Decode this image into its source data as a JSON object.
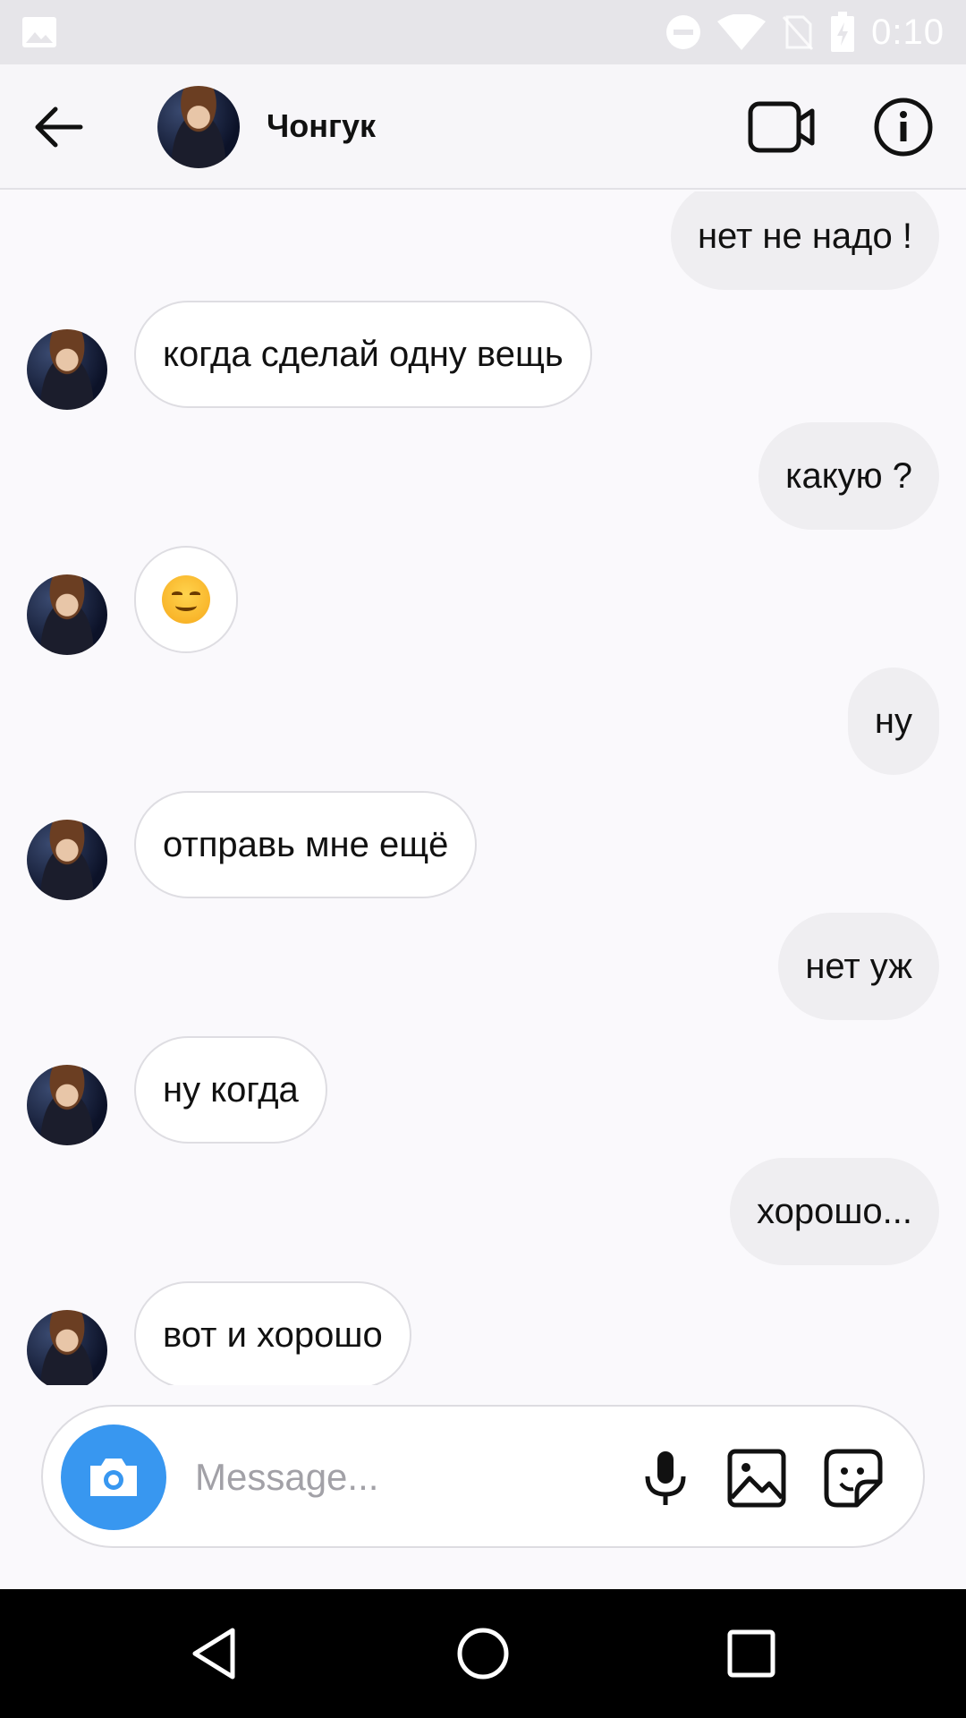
{
  "status_bar": {
    "time": "0:10",
    "icons": [
      "image-icon",
      "do-not-disturb-icon",
      "wifi-icon",
      "no-sim-icon",
      "battery-charging-icon"
    ]
  },
  "header": {
    "contact_name": "Чонгук",
    "icons": [
      "back-arrow-icon",
      "video-call-icon",
      "info-icon"
    ]
  },
  "messages": [
    {
      "from": "me",
      "text": "нет не надо !"
    },
    {
      "from": "them",
      "text": "когда сделай одну вещь"
    },
    {
      "from": "me",
      "text": "какую ?"
    },
    {
      "from": "them",
      "text": "",
      "emoji": "smiling-face-emoji"
    },
    {
      "from": "me",
      "text": "ну"
    },
    {
      "from": "them",
      "text": "отправь мне ещё"
    },
    {
      "from": "me",
      "text": "нет уж"
    },
    {
      "from": "them",
      "text": "ну когда"
    },
    {
      "from": "me",
      "text": "хорошо..."
    },
    {
      "from": "them",
      "text": "вот и хорошо"
    }
  ],
  "composer": {
    "placeholder": "Message...",
    "value": "",
    "camera_color": "#3897f0",
    "icons": [
      "camera-icon",
      "microphone-icon",
      "gallery-icon",
      "sticker-icon"
    ]
  },
  "nav_bar": {
    "icons": [
      "nav-back-icon",
      "nav-home-icon",
      "nav-recents-icon"
    ]
  }
}
